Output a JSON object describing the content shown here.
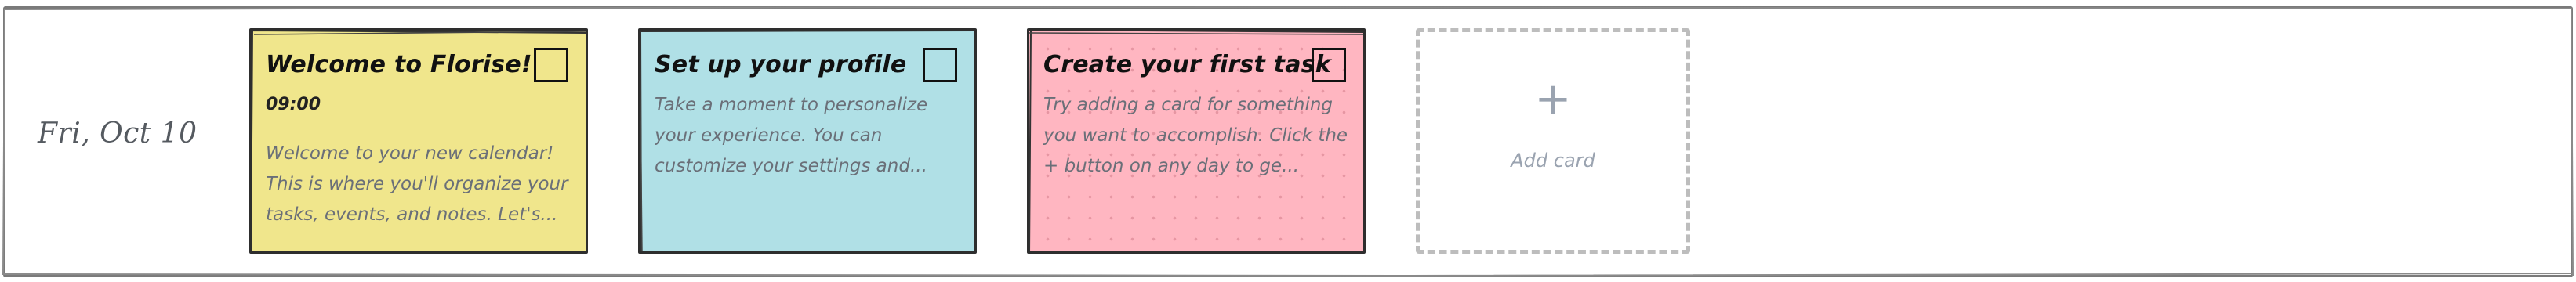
{
  "day": {
    "date_label": "Fri, Oct 10"
  },
  "cards": [
    {
      "title": "Welcome to Florise!",
      "time": "09:00",
      "body": "Welcome to your new calendar! This is where you'll organize your tasks, events, and notes. Let's...",
      "color": "#f0e68c",
      "completed": false
    },
    {
      "title": "Set up your profile",
      "body": "Take a moment to personalize your experience. You can customize your settings and...",
      "color": "#b0e0e6",
      "completed": false
    },
    {
      "title": "Create your first task",
      "body": "Try adding a card for something you want to accomplish. Click the + button on any day to ge...",
      "color": "#ffb6c1",
      "pattern": "dots",
      "completed": false
    }
  ],
  "add_card": {
    "icon": "plus-icon",
    "label": "Add card"
  },
  "colors": {
    "frame_border": "#7a7a7a",
    "card_border": "#2e2e2e",
    "muted_text": "#6a6f78",
    "placeholder_text": "#9aa3b0"
  }
}
